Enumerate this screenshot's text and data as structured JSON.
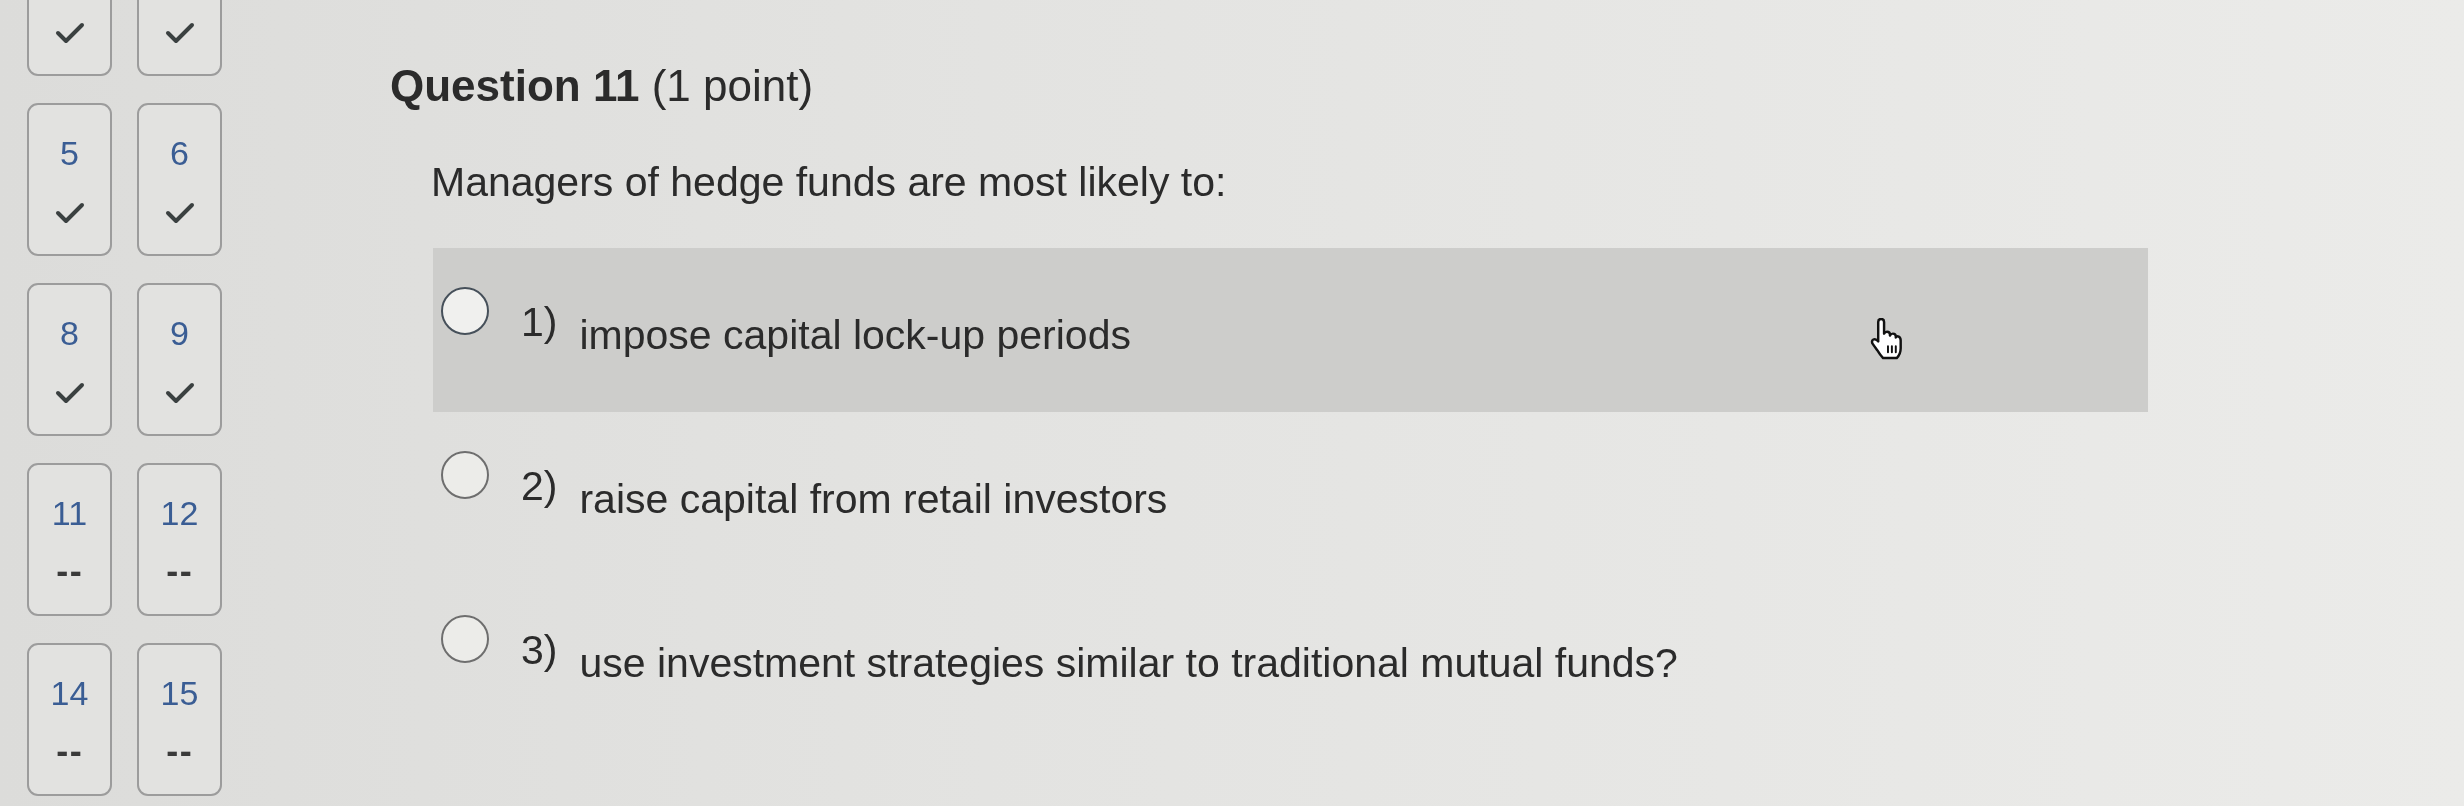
{
  "nav": {
    "tiles": [
      {
        "answered": true
      },
      {
        "answered": true
      },
      {
        "number": "5",
        "answered": true
      },
      {
        "number": "6",
        "answered": true
      },
      {
        "number": "8",
        "answered": true
      },
      {
        "number": "9",
        "answered": true
      },
      {
        "number": "11",
        "answered": false,
        "status_text": "--"
      },
      {
        "number": "12",
        "answered": false,
        "status_text": "--"
      },
      {
        "number": "14",
        "answered": false,
        "status_text": "--"
      },
      {
        "number": "15",
        "answered": false,
        "status_text": "--"
      }
    ]
  },
  "question": {
    "title": "**Question 11** (1 point)",
    "prompt": "Managers of hedge funds are most likely to:",
    "options": [
      {
        "number": "1)",
        "text": "impose capital lock-up periods",
        "selected": false,
        "highlighted": true
      },
      {
        "number": "2)",
        "text": "raise capital from retail investors",
        "selected": false,
        "highlighted": false
      },
      {
        "number": "3)",
        "text": "use investment strategies similar to traditional mutual funds?",
        "selected": false,
        "highlighted": false
      }
    ]
  }
}
